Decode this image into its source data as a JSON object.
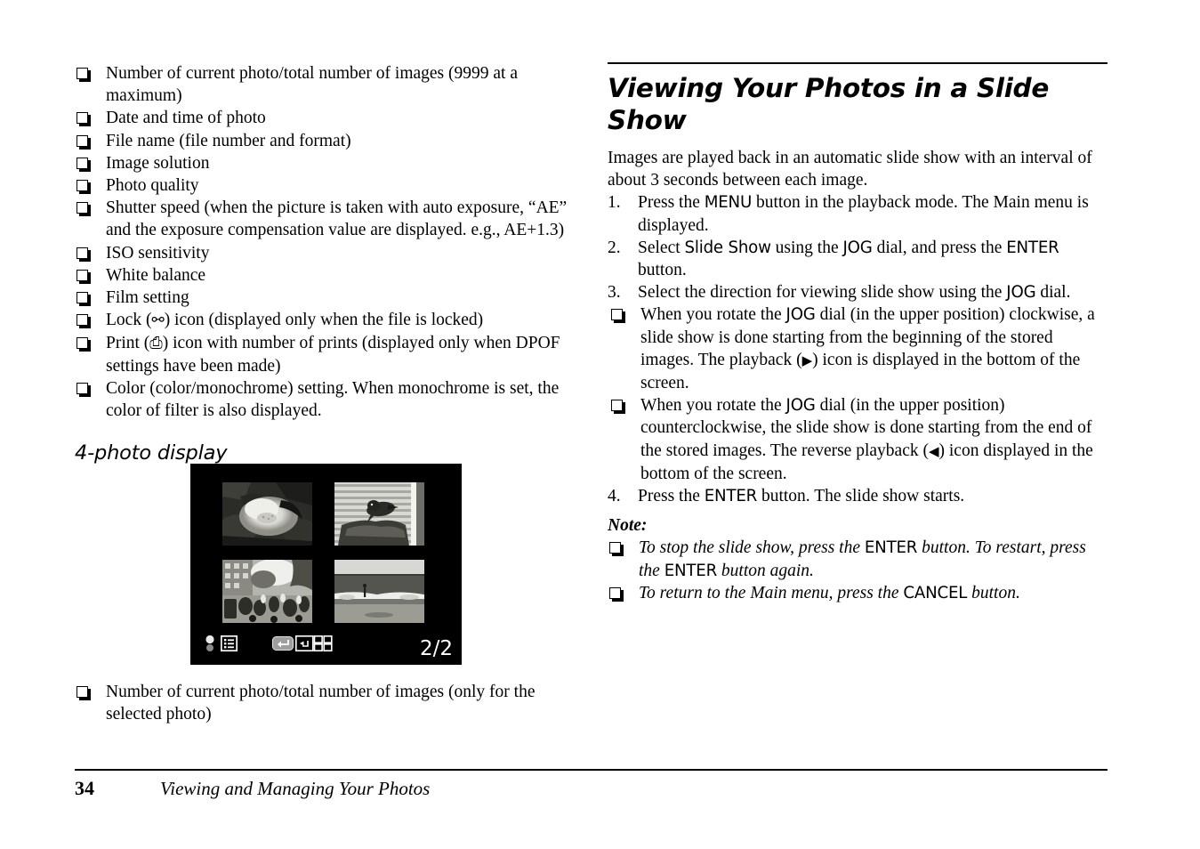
{
  "page": {
    "folio": "34",
    "footer_title": "Viewing and Managing Your Photos"
  },
  "left_column": {
    "info_bullets": [
      "Number of current photo/total number of images (9999 at a maximum)",
      "Date and time of photo",
      "File name (file number and format)",
      "Image solution",
      "Photo quality",
      "Shutter speed (when the picture is taken with auto exposure, “AE” and the exposure compensation value are displayed. e.g., AE+1.3)",
      "ISO sensitivity",
      "White balance",
      "Film setting"
    ],
    "lock_bullet": {
      "before": "Lock (",
      "icon": "lock-icon",
      "icon_glyph": "⚯",
      "after": ") icon (displayed only when the file is locked)"
    },
    "print_bullet": {
      "before": "Print (",
      "icon": "printer-icon",
      "icon_glyph": "⎙",
      "after": ") icon with number of prints (displayed only when DPOF settings have been made)"
    },
    "color_bullet": "Color (color/monochrome) setting. When monochrome is set, the color of filter is also displayed.",
    "subheading": "4-photo display",
    "figure": {
      "name": "camera-lcd-4-photo-display",
      "counter": "2/2",
      "thumbnails": [
        {
          "name": "thumbnail-flower",
          "caption": "flower"
        },
        {
          "name": "thumbnail-bird-on-blinds",
          "caption": "bird"
        },
        {
          "name": "thumbnail-street-scene",
          "caption": "street"
        },
        {
          "name": "thumbnail-beach",
          "caption": "beach"
        }
      ],
      "status_icons": [
        "battery-icon",
        "list-view-icon",
        "enter-key-icon",
        "thumbnail-grid-icon"
      ]
    },
    "after_figure_bullet": "Number of current photo/total number of images (only for the selected photo)"
  },
  "right_column": {
    "section_title": "Viewing Your Photos in a Slide Show",
    "intro": "Images are played back in an automatic slide show with an interval of about 3 seconds between each image.",
    "steps": [
      {
        "number": "1.",
        "parts": [
          {
            "t": "text",
            "v": "Press the "
          },
          {
            "t": "btn",
            "v": "MENU"
          },
          {
            "t": "text",
            "v": " button in the playback mode. The Main menu is displayed."
          }
        ]
      },
      {
        "number": "2.",
        "parts": [
          {
            "t": "text",
            "v": "Select "
          },
          {
            "t": "btn",
            "v": "Slide Show"
          },
          {
            "t": "text",
            "v": " using the "
          },
          {
            "t": "btn",
            "v": "JOG"
          },
          {
            "t": "text",
            "v": " dial, and press the "
          },
          {
            "t": "btn",
            "v": "ENTER"
          },
          {
            "t": "text",
            "v": " button."
          }
        ]
      },
      {
        "number": "3.",
        "parts": [
          {
            "t": "text",
            "v": "Select the direction for viewing slide show using the "
          },
          {
            "t": "btn",
            "v": "JOG"
          },
          {
            "t": "text",
            "v": " dial."
          }
        ]
      }
    ],
    "step3_subbullets": [
      {
        "parts": [
          {
            "t": "text",
            "v": "When you rotate the "
          },
          {
            "t": "btn",
            "v": "JOG"
          },
          {
            "t": "text",
            "v": " dial (in the upper position) clockwise, a slide show is done starting from the beginning of the stored images. The playback ("
          },
          {
            "t": "glyph",
            "v": "▶",
            "name": "playback-icon"
          },
          {
            "t": "text",
            "v": ") icon is displayed in the bottom of the screen."
          }
        ]
      },
      {
        "parts": [
          {
            "t": "text",
            "v": "When you rotate the "
          },
          {
            "t": "btn",
            "v": "JOG"
          },
          {
            "t": "text",
            "v": " dial (in the upper position) counterclockwise, the slide show is done starting from the end of the stored images. The reverse playback ("
          },
          {
            "t": "glyph",
            "v": "◀",
            "name": "reverse-playback-icon"
          },
          {
            "t": "text",
            "v": ") icon displayed in the bottom of the screen."
          }
        ]
      }
    ],
    "step4": {
      "number": "4.",
      "parts": [
        {
          "t": "text",
          "v": "Press the "
        },
        {
          "t": "btn",
          "v": "ENTER"
        },
        {
          "t": "text",
          "v": " button. The slide show starts."
        }
      ]
    },
    "note": {
      "heading": "Note:",
      "items": [
        {
          "parts": [
            {
              "t": "text",
              "v": "To stop the slide show, press the "
            },
            {
              "t": "btn",
              "v": "ENTER"
            },
            {
              "t": "text",
              "v": " button. To restart, press the "
            },
            {
              "t": "btn",
              "v": "ENTER"
            },
            {
              "t": "text",
              "v": " button again."
            }
          ]
        },
        {
          "parts": [
            {
              "t": "text",
              "v": "To return to the Main menu, press the "
            },
            {
              "t": "btn",
              "v": "CANCEL"
            },
            {
              "t": "text",
              "v": " button."
            }
          ]
        }
      ]
    }
  }
}
